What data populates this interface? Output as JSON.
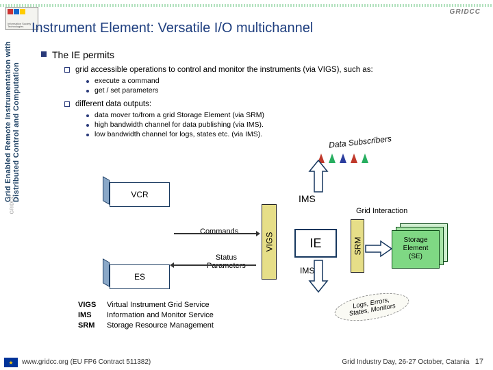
{
  "brand": {
    "top_right": "GRIDCC",
    "sidebar_project": "GRIDCC",
    "sidebar_text": "Grid Enabled Remote Instrumentation with\nDistributed Control and Computation"
  },
  "title": "Instrument Element: Versatile I/O multichannel",
  "bullets": {
    "l1": "The IE permits",
    "l2a": "grid accessible operations to control and monitor the instruments (via VIGS), such as:",
    "l2a_sub": [
      "execute a command",
      "get / set  parameters"
    ],
    "l2b": "different data outputs:",
    "l2b_sub": [
      "data mover to/from a grid Storage Element (via SRM)",
      "high bandwidth channel for data publishing (via IMS).",
      "low bandwidth channel for logs, states etc. (via IMS)."
    ]
  },
  "diagram": {
    "vcr": "VCR",
    "es": "ES",
    "vigs": "VIGS",
    "srm": "SRM",
    "ie": "IE",
    "ims_top": "IMS",
    "ims_bottom": "IMS",
    "commands": "Commands",
    "status": "Status\nParameters",
    "grid_interaction": "Grid Interaction",
    "storage_element": "Storage\nElement\n(SE)",
    "subscribers": "Data Subscribers",
    "cloud": "Logs, Errors,\nStates, Monitors"
  },
  "acronyms": [
    {
      "k": "VIGS",
      "v": "Virtual Instrument Grid Service"
    },
    {
      "k": "IMS",
      "v": "Information and Monitor Service"
    },
    {
      "k": "SRM",
      "v": "Storage Resource Management"
    }
  ],
  "footer": {
    "left": "www.gridcc.org (EU FP6 Contract 511382)",
    "right": "Grid Industry Day, 26-27 October, Catania",
    "page": "17"
  }
}
